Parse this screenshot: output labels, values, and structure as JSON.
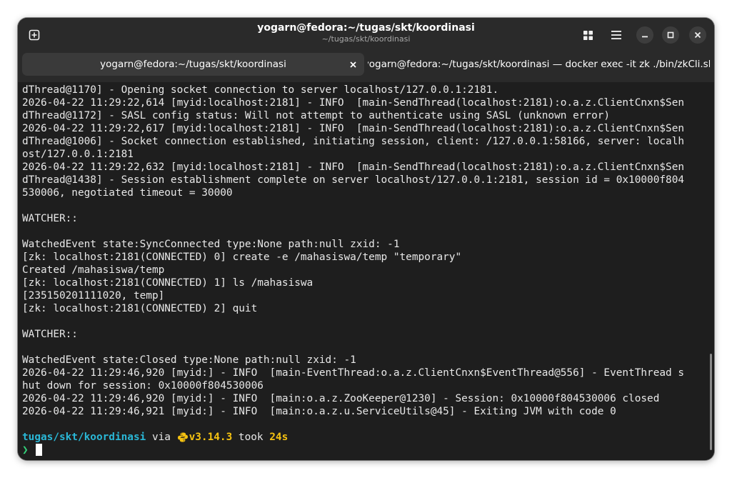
{
  "window": {
    "title": "yogarn@fedora:~/tugas/skt/koordinasi",
    "subtitle": "~/tugas/skt/koordinasi"
  },
  "header_buttons": {
    "new_tab_icon": "new-tab-icon",
    "tab_overview_icon": "grid-icon",
    "menu_icon": "hamburger-menu-icon",
    "minimize_icon": "minimize-icon",
    "maximize_icon": "maximize-icon",
    "close_icon": "close-icon"
  },
  "tabs": [
    {
      "label": "yogarn@fedora:~/tugas/skt/koordinasi",
      "active": true
    },
    {
      "label": "yogarn@fedora:~/tugas/skt/koordinasi — docker exec -it zk ./bin/zkCli.sh",
      "active": false
    }
  ],
  "terminal": {
    "lines": [
      "dThread@1170] - Opening socket connection to server localhost/127.0.0.1:2181.",
      "2026-04-22 11:29:22,614 [myid:localhost:2181] - INFO  [main-SendThread(localhost:2181):o.a.z.ClientCnxn$Sen",
      "dThread@1172] - SASL config status: Will not attempt to authenticate using SASL (unknown error)",
      "2026-04-22 11:29:22,617 [myid:localhost:2181] - INFO  [main-SendThread(localhost:2181):o.a.z.ClientCnxn$Sen",
      "dThread@1006] - Socket connection established, initiating session, client: /127.0.0.1:58166, server: localh",
      "ost/127.0.0.1:2181",
      "2026-04-22 11:29:22,632 [myid:localhost:2181] - INFO  [main-SendThread(localhost:2181):o.a.z.ClientCnxn$Sen",
      "dThread@1438] - Session establishment complete on server localhost/127.0.0.1:2181, session id = 0x10000f804",
      "530006, negotiated timeout = 30000",
      "",
      "WATCHER::",
      "",
      "WatchedEvent state:SyncConnected type:None path:null zxid: -1",
      "[zk: localhost:2181(CONNECTED) 0] create -e /mahasiswa/temp \"temporary\"",
      "Created /mahasiswa/temp",
      "[zk: localhost:2181(CONNECTED) 1] ls /mahasiswa",
      "[235150201111020, temp]",
      "[zk: localhost:2181(CONNECTED) 2] quit",
      "",
      "WATCHER::",
      "",
      "WatchedEvent state:Closed type:None path:null zxid: -1",
      "2026-04-22 11:29:46,920 [myid:] - INFO  [main-EventThread:o.a.z.ClientCnxn$EventThread@556] - EventThread s",
      "hut down for session: 0x10000f804530006",
      "2026-04-22 11:29:46,920 [myid:] - INFO  [main:o.a.z.ZooKeeper@1230] - Session: 0x10000f804530006 closed",
      "2026-04-22 11:29:46,921 [myid:] - INFO  [main:o.a.z.u.ServiceUtils@45] - Exiting JVM with code 0",
      ""
    ],
    "prompt": {
      "dir": "tugas/skt/koordinasi",
      "via": " via ",
      "python_icon": "python-icon",
      "version": "v3.14.3",
      "took": " took ",
      "duration": "24s",
      "symbol": "❯"
    }
  },
  "colors": {
    "prompt_dir": "#2ab7d6",
    "prompt_version": "#f5c211",
    "prompt_symbol": "#33d17a",
    "background": "#1e1e1e"
  }
}
